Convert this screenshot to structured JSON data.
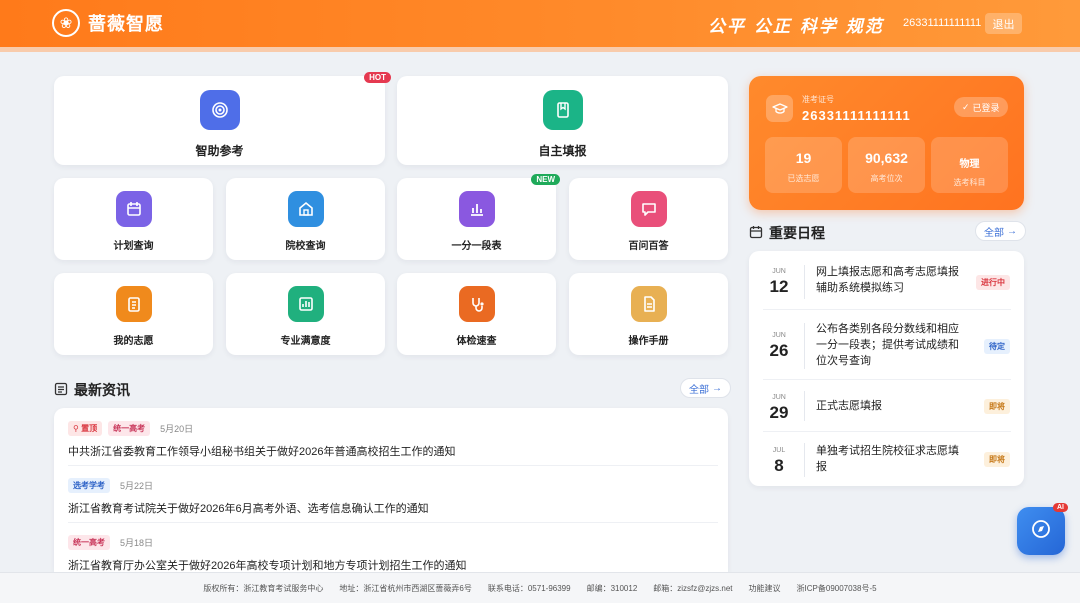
{
  "header": {
    "brand": "蔷薇智愿",
    "slogan": "公平 公正 科学 规范",
    "user_id": "26331111111111",
    "logout": "退出"
  },
  "tiles": [
    {
      "id": "zhizhu",
      "label": "智助参考",
      "color": "#4f6ee8",
      "icon": "target-icon",
      "badge": "HOT"
    },
    {
      "id": "zizhu",
      "label": "自主填报",
      "color": "#1bb487",
      "icon": "book-icon"
    },
    {
      "id": "jihua",
      "label": "计划查询",
      "color": "#7b63e6",
      "icon": "calendar-icon"
    },
    {
      "id": "yuanxiao",
      "label": "院校查询",
      "color": "#2f8fe0",
      "icon": "building-icon"
    },
    {
      "id": "yifen",
      "label": "一分一段表",
      "color": "#8a58e0",
      "icon": "bar-chart-icon",
      "badge": "NEW"
    },
    {
      "id": "baiwen",
      "label": "百问百答",
      "color": "#e94f7a",
      "icon": "chat-icon"
    },
    {
      "id": "wodezhiyuan",
      "label": "我的志愿",
      "color": "#f08a1c",
      "icon": "clipboard-icon"
    },
    {
      "id": "manyidu",
      "label": "专业满意度",
      "color": "#20b07e",
      "icon": "chart-icon"
    },
    {
      "id": "tijian",
      "label": "体检速查",
      "color": "#ea6a22",
      "icon": "stethoscope-icon"
    },
    {
      "id": "shouce",
      "label": "操作手册",
      "color": "#e8b053",
      "icon": "document-icon"
    }
  ],
  "news": {
    "title": "最新资讯",
    "more": "全部",
    "items": [
      {
        "tags": [
          {
            "text": "置顶",
            "style": "red"
          },
          {
            "text": "统一高考",
            "style": "pink"
          }
        ],
        "date": "5月20日",
        "title": "中共浙江省委教育工作领导小组秘书组关于做好2026年普通高校招生工作的通知"
      },
      {
        "tags": [
          {
            "text": "选考学考",
            "style": "blue"
          }
        ],
        "date": "5月22日",
        "title": "浙江省教育考试院关于做好2026年6月高考外语、选考信息确认工作的通知"
      },
      {
        "tags": [
          {
            "text": "统一高考",
            "style": "pink"
          }
        ],
        "date": "5月18日",
        "title": "浙江省教育厅办公室关于做好2026年高校专项计划和地方专项计划招生工作的通知"
      }
    ]
  },
  "profile": {
    "label": "准考证号",
    "number": "26331111111111",
    "verified": "已登录",
    "stats": [
      {
        "value": "19",
        "label": "已选志愿"
      },
      {
        "value": "90,632",
        "label": "高考位次"
      },
      {
        "value": "物理",
        "label": "选考科目"
      }
    ]
  },
  "schedule": {
    "title": "重要日程",
    "more": "全部",
    "items": [
      {
        "month": "JUN",
        "day": "12",
        "text": "网上填报志愿和高考志愿填报辅助系统模拟练习",
        "status": "进行中",
        "status_style": "red"
      },
      {
        "month": "JUN",
        "day": "26",
        "text": "公布各类别各段分数线和相应一分一段表；提供考试成绩和位次号查询",
        "status": "待定",
        "status_style": "blue"
      },
      {
        "month": "JUN",
        "day": "29",
        "text": "正式志愿填报",
        "status": "即将",
        "status_style": "orange"
      },
      {
        "month": "JUL",
        "day": "8",
        "text": "单独考试招生院校征求志愿填报",
        "status": "即将",
        "status_style": "orange"
      }
    ]
  },
  "ai": {
    "tag": "AI"
  },
  "footer": {
    "copyright": "版权所有：浙江教育考试服务中心",
    "address": "地址：浙江省杭州市西湖区蔷薇弄6号",
    "phone": "联系电话：0571-96399",
    "postcode": "邮编：310012",
    "email": "邮箱：zizsfz@zjzs.net",
    "feedback": "功能建议",
    "icp": "浙ICP备09007038号-5"
  }
}
